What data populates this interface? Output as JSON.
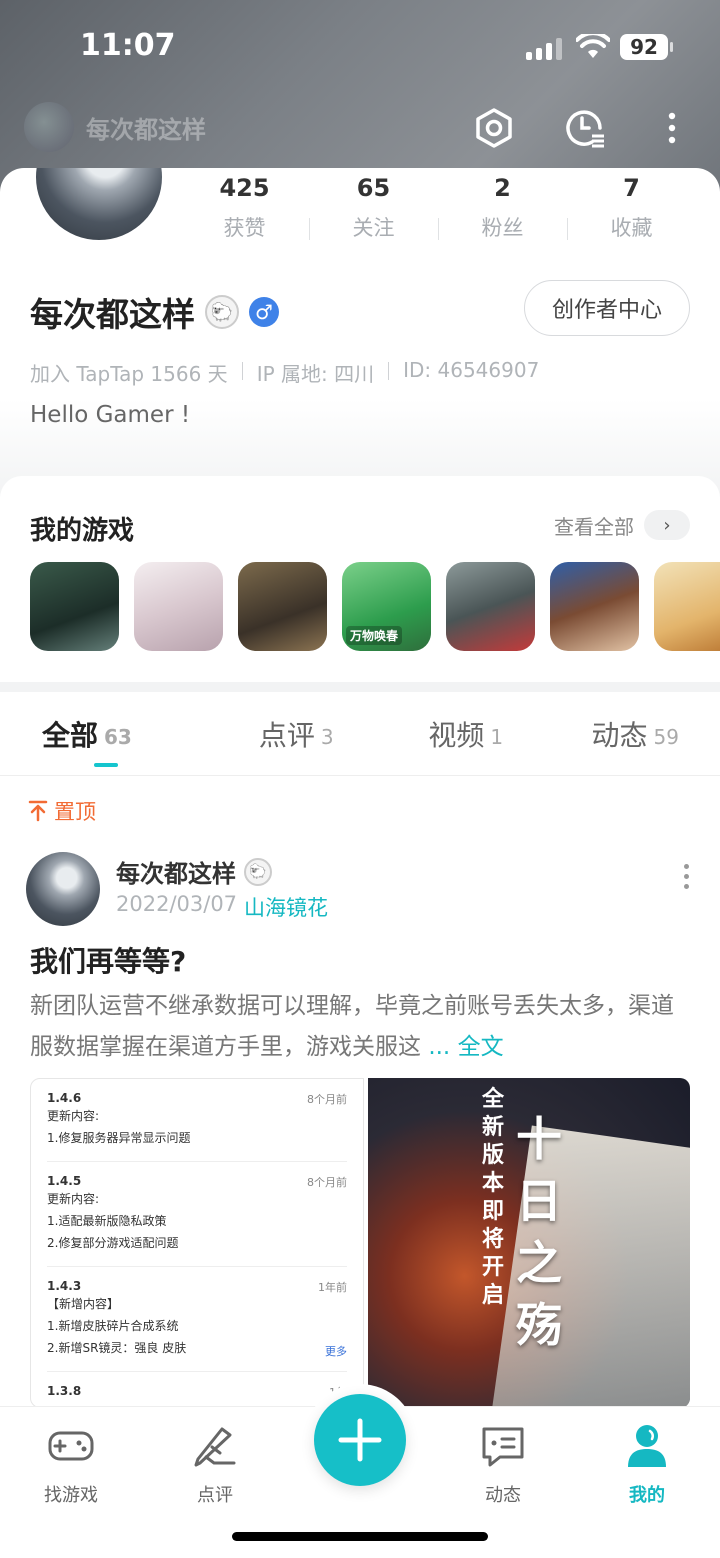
{
  "status_bar": {
    "time": "11:07",
    "battery": "92"
  },
  "header": {
    "mini_name": "每次都这样"
  },
  "profile": {
    "stats": [
      {
        "num": "425",
        "label": "获赞"
      },
      {
        "num": "65",
        "label": "关注"
      },
      {
        "num": "2",
        "label": "粉丝"
      },
      {
        "num": "7",
        "label": "收藏"
      }
    ],
    "name": "每次都这样",
    "creator_button": "创作者中心",
    "joined": "加入 TapTap 1566 天",
    "ip": "IP 属地: 四川",
    "id": "ID: 46546907",
    "bio": "Hello Gamer !"
  },
  "games": {
    "title": "我的游戏",
    "view_all": "查看全部",
    "icons": [
      "game-1",
      "game-2",
      "game-3",
      "game-4",
      "game-5",
      "game-6",
      "game-7"
    ],
    "game4_tag": "万物唤春"
  },
  "tabs": [
    {
      "label": "全部",
      "count": "63",
      "active": true
    },
    {
      "label": "点评",
      "count": "3"
    },
    {
      "label": "视频",
      "count": "1"
    },
    {
      "label": "动态",
      "count": "59"
    }
  ],
  "post": {
    "pinned_label": "置顶",
    "author": "每次都这样",
    "date": "2022/03/07",
    "game": "山海镜花",
    "title": "我们再等等?",
    "body": "新团队运营不继承数据可以理解，毕竟之前账号丢失太多，渠道服数据掌握在渠道方手里，游戏关服这",
    "ellipsis": "...",
    "full_text": "全文",
    "changelog": [
      {
        "version": "1.4.6",
        "ago": "8个月前",
        "lines": [
          "更新内容:",
          "1.修复服务器异常显示问题"
        ]
      },
      {
        "version": "1.4.5",
        "ago": "8个月前",
        "lines": [
          "更新内容:",
          "1.适配最新版隐私政策",
          "2.修复部分游戏适配问题"
        ]
      },
      {
        "version": "1.4.3",
        "ago": "1年前",
        "lines": [
          "【新增内容】",
          "1.新增皮肤碎片合成系统",
          "2.新增SR镜灵：强良 皮肤"
        ],
        "more": "更多"
      },
      {
        "version": "1.3.8",
        "ago": "1年",
        "lines": []
      }
    ],
    "poster_vertical": "全新版本即将开启",
    "poster_title": "十日之殇"
  },
  "bottom_nav": [
    {
      "label": "找游戏",
      "icon": "gamepad-icon"
    },
    {
      "label": "点评",
      "icon": "pen-icon"
    },
    {
      "label": "动态",
      "icon": "chat-icon"
    },
    {
      "label": "我的",
      "icon": "user-icon",
      "active": true
    }
  ],
  "colors": {
    "accent": "#15b8c2",
    "pin": "#f26b34",
    "male": "#3f82e8"
  }
}
